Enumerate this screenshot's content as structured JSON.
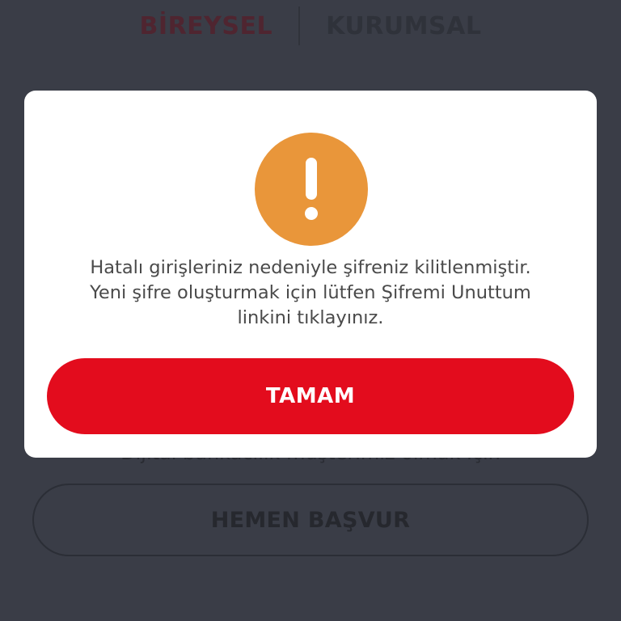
{
  "colors": {
    "overlay_background": "#3a3d47",
    "modal_background": "#ffffff",
    "warning_badge": "#e9963a",
    "primary_button": "#e30c1d",
    "message_text": "#4a4a4a"
  },
  "background": {
    "tabs": {
      "individual": "BİREYSEL",
      "corporate": "KURUMSAL"
    },
    "subtext": "Dijital bankacılık müşterimiz olmak için",
    "apply_button_label": "HEMEN BAŞVUR"
  },
  "dialog": {
    "icon": "exclamation-icon",
    "message_lines": [
      "Hatalı girişleriniz nedeniyle şifreniz kilitlenmiştir.",
      "Yeni şifre oluşturmak için lütfen Şifremi Unuttum",
      "linkini tıklayınız."
    ],
    "ok_button_label": "TAMAM"
  }
}
